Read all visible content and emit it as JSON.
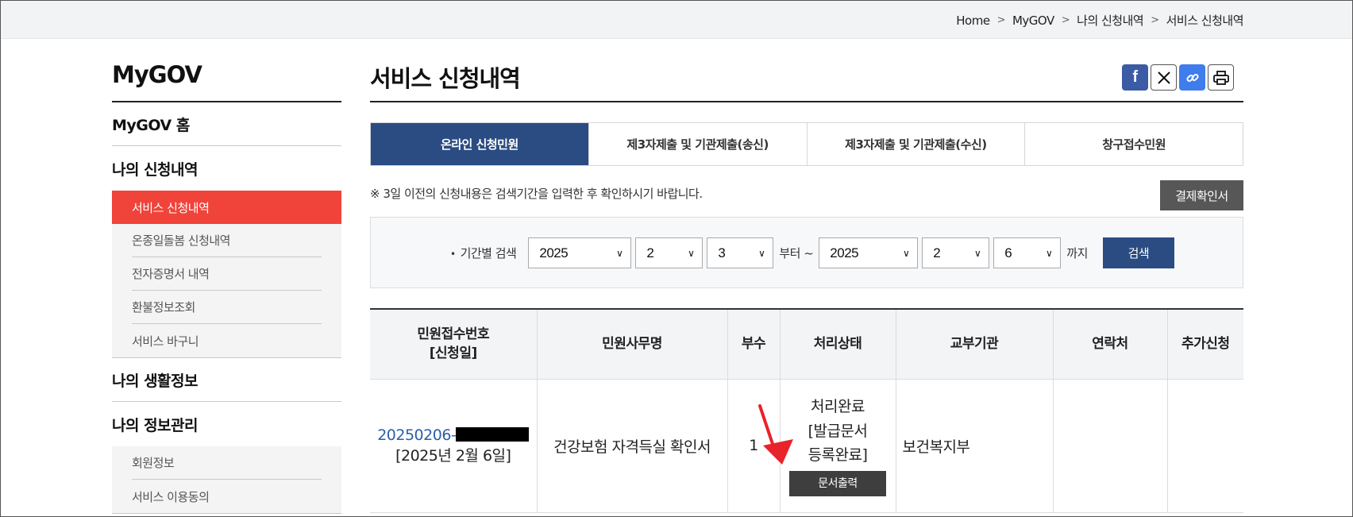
{
  "breadcrumb": [
    "Home",
    "MyGOV",
    "나의 신청내역",
    "서비스 신청내역"
  ],
  "sidebar": {
    "title": "MyGOV",
    "sections": [
      {
        "label": "MyGOV 홈"
      },
      {
        "label": "나의 신청내역",
        "items": [
          "서비스 신청내역",
          "온종일돌봄 신청내역",
          "전자증명서 내역",
          "환불정보조회",
          "서비스 바구니"
        ],
        "active": "서비스 신청내역"
      },
      {
        "label": "나의 생활정보"
      },
      {
        "label": "나의 정보관리",
        "items": [
          "회원정보",
          "서비스 이용동의"
        ]
      }
    ]
  },
  "page_title": "서비스 신청내역",
  "share_icons": [
    "facebook-icon",
    "x-icon",
    "link-icon",
    "print-icon"
  ],
  "tabs": [
    {
      "label": "온라인 신청민원",
      "active": true
    },
    {
      "label": "제3자제출 및 기관제출(송신)",
      "active": false
    },
    {
      "label": "제3자제출 및 기관제출(수신)",
      "active": false
    },
    {
      "label": "창구접수민원",
      "active": false
    }
  ],
  "notice": "※ 3일 이전의 신청내용은 검색기간을 입력한 후 확인하시기 바랍니다.",
  "pay_check_button": "결제확인서",
  "search": {
    "label": "기간별 검색",
    "from": {
      "year": "2025",
      "month": "2",
      "day": "3"
    },
    "from_suffix": "부터 ~",
    "to": {
      "year": "2025",
      "month": "2",
      "day": "6"
    },
    "to_suffix": "까지",
    "button": "검색"
  },
  "table": {
    "headers": [
      "민원접수번호",
      "[신청일]",
      "민원사무명",
      "부수",
      "처리상태",
      "교부기관",
      "연락처",
      "추가신청"
    ],
    "rows": [
      {
        "receipt_no": "20250206-",
        "apply_date": "[2025년 2월 6일]",
        "name": "건강보험 자격득실 확인서",
        "copies": "1",
        "status_1": "처리완료",
        "status_2": "[발급문서",
        "status_3": "등록완료]",
        "print_button": "문서출력",
        "agency": "보건복지부",
        "contact": "",
        "extra": ""
      }
    ]
  },
  "colors": {
    "accent_red": "#f0433a",
    "navy": "#2b4c82",
    "arrow_red": "#e8232a"
  }
}
